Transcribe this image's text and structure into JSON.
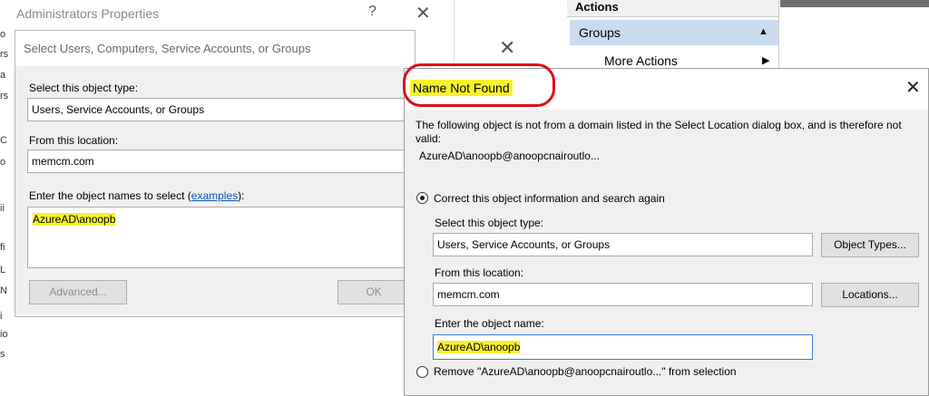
{
  "admin_window": {
    "title": "Administrators Properties",
    "help_glyph": "?",
    "close_glyph": "✕",
    "left_strip_chars": [
      "o",
      "rs",
      "a",
      "rs",
      "C",
      "o",
      "ii",
      "fi",
      "L",
      "N",
      "i",
      "io",
      "s"
    ]
  },
  "actions_pane": {
    "header": "Actions",
    "group_label": "Groups",
    "group_arrow": "▲",
    "more_actions": "More Actions",
    "more_arrow": "▶"
  },
  "select_dialog": {
    "title": "Select Users, Computers, Service Accounts, or Groups",
    "close_glyph": "✕",
    "object_type_label": "Select this object type:",
    "object_type_value": "Users, Service Accounts, or Groups",
    "location_label": "From this location:",
    "location_value": "memcm.com",
    "names_label_prefix": "Enter the object names to select (",
    "names_label_link": "examples",
    "names_label_suffix": "):",
    "names_value": "AzureAD\\anoopb",
    "advanced_button": "Advanced...",
    "ok_button": "OK"
  },
  "name_not_found": {
    "title": "Name Not Found",
    "close_glyph": "✕",
    "message": "The following object is not from a domain listed in the Select Location dialog box, and is therefore not valid:",
    "object": "AzureAD\\anoopb@anoopcnairoutlo...",
    "option_correct": "Correct this object information and search again",
    "object_type_label": "Select this object type:",
    "object_type_value": "Users, Service Accounts, or Groups",
    "object_types_button": "Object Types...",
    "location_label": "From this location:",
    "location_value": "memcm.com",
    "locations_button": "Locations...",
    "name_label": "Enter the object name:",
    "name_value": "AzureAD\\anoopb",
    "option_remove": "Remove \"AzureAD\\anoopb@anoopcnairoutlo...\" from selection"
  },
  "colors": {
    "highlight": "#f6f22b",
    "annotation_red": "#e00d16",
    "link": "#0b56c4",
    "selection_blue": "#c9dcef"
  }
}
